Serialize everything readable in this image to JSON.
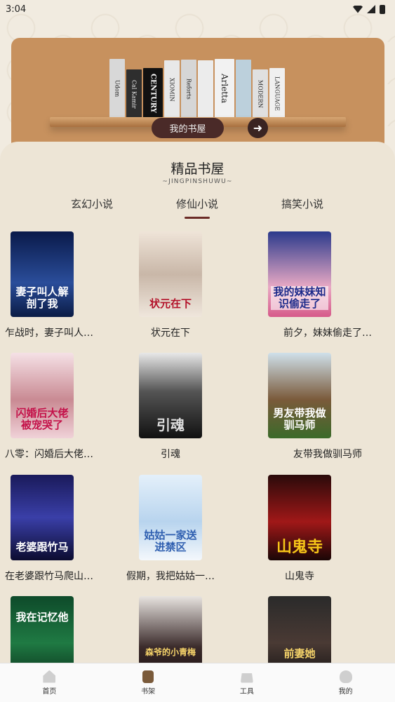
{
  "status_bar": {
    "time": "3:04"
  },
  "banner": {
    "books": [
      "Udom",
      "Cal Kamir",
      "CENTURY",
      "XIOMIN",
      "Reforts",
      "",
      "Arletta",
      "",
      "MODERN",
      "LANGUAGE"
    ],
    "button_label": "我的书屋",
    "arrow": "➜"
  },
  "section": {
    "title": "精品书屋",
    "subtitle": "~JINGPINSHUWU~",
    "tabs": [
      {
        "label": "玄幻小说"
      },
      {
        "label": "修仙小说"
      },
      {
        "label": "搞笑小说"
      }
    ]
  },
  "books": [
    {
      "title": "乍战时，妻子叫人…",
      "cover_text": "妻子叫人解剖了我"
    },
    {
      "title": "状元在下",
      "cover_text": "状元在下"
    },
    {
      "title": "前夕，妹妹偷走了…",
      "cover_text": "我的妹妹知识偷走了"
    },
    {
      "title": "八零：闪婚后大佬…",
      "cover_text": "闪婚后大佬被宠哭了"
    },
    {
      "title": "引魂",
      "cover_text": "引魂"
    },
    {
      "title": "友带我做驯马师",
      "cover_text": "男友带我做驯马师"
    },
    {
      "title": "在老婆跟竹马爬山…",
      "cover_text": "老婆跟竹马"
    },
    {
      "title": "假期，我把姑姑一…",
      "cover_text": "姑姑一家送进禁区"
    },
    {
      "title": "山鬼寺",
      "cover_text": "山鬼寺"
    },
    {
      "title": "",
      "cover_text": "我在记忆他"
    },
    {
      "title": "",
      "cover_text": "森爷的小青梅"
    },
    {
      "title": "",
      "cover_text": "前妻她"
    }
  ],
  "bottom_nav": [
    {
      "label": "首页",
      "icon": "home-icon"
    },
    {
      "label": "书架",
      "icon": "bookshelf-icon"
    },
    {
      "label": "工具",
      "icon": "toolbox-icon"
    },
    {
      "label": "我的",
      "icon": "profile-icon"
    }
  ]
}
